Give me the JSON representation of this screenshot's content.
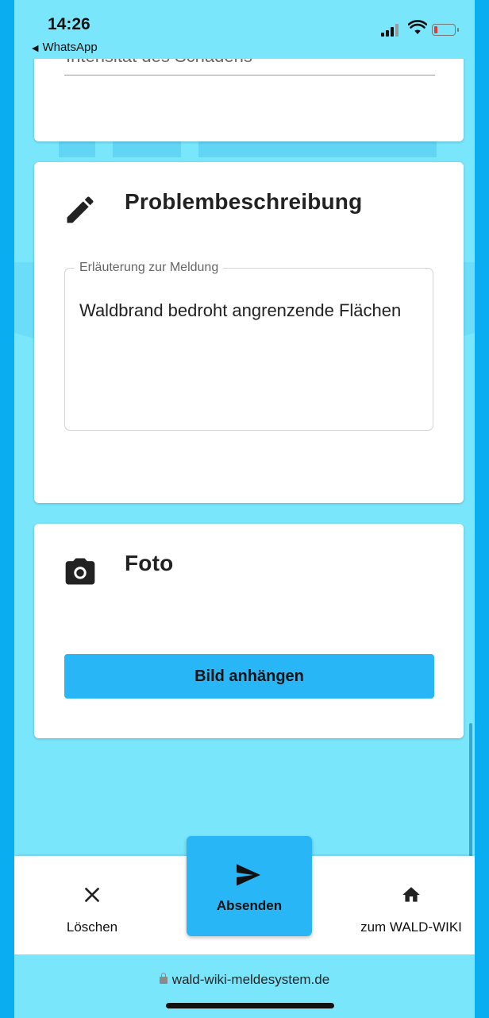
{
  "statusbar": {
    "time": "14:26",
    "back_app": "WhatsApp"
  },
  "colors": {
    "background": "#7ae6fb",
    "frame": "#0aaef0",
    "primary_button": "#29b6f6",
    "card": "#ffffff"
  },
  "damage_section": {
    "field_text": "Intensität des Schadens"
  },
  "description_section": {
    "icon": "pencil-icon",
    "title": "Problembeschreibung",
    "field_label": "Erläuterung zur Meldung",
    "field_value": "Waldbrand bedroht angrenzende Flächen"
  },
  "photo_section": {
    "icon": "camera-icon",
    "title": "Foto",
    "attach_label": "Bild anhängen"
  },
  "bottom_nav": {
    "delete_label": "Löschen",
    "delete_icon": "close-icon",
    "send_label": "Absenden",
    "send_icon": "send-icon",
    "home_label": "zum WALD-WIKI",
    "home_icon": "home-icon"
  },
  "browser": {
    "url": "wald-wiki-meldesystem.de"
  }
}
